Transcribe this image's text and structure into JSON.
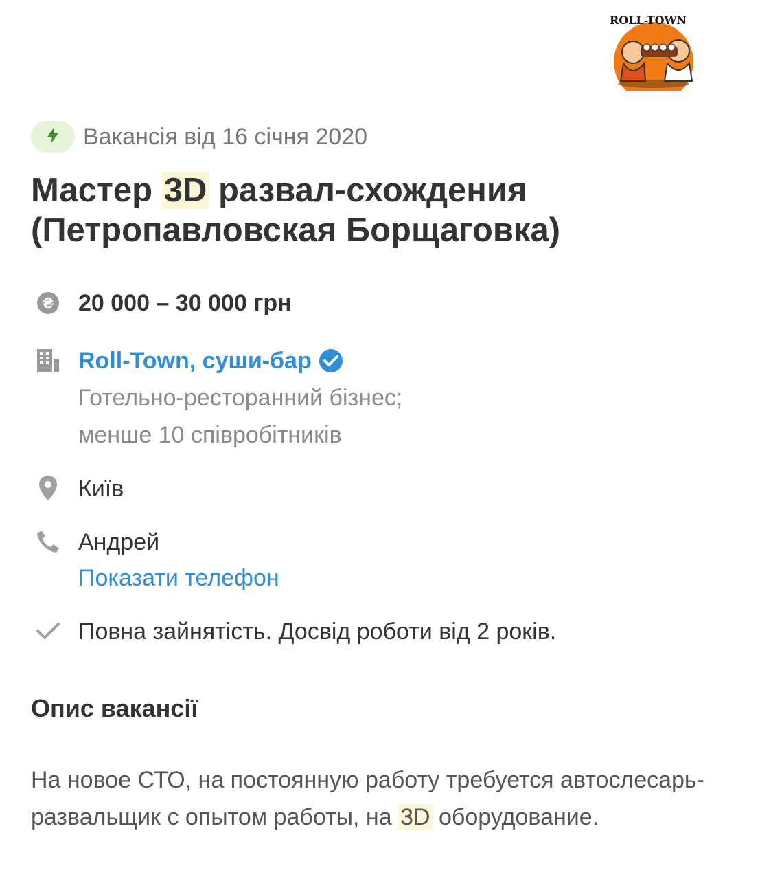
{
  "logo": {
    "text": "ROLL-TOWN"
  },
  "posting": {
    "date": "Вакансія від 16 січня 2020"
  },
  "title": {
    "part1": "Мастер ",
    "highlight": "3D",
    "part2": " развал-схождения (Петропавловская Борщаговка)"
  },
  "salary": "20 000 – 30 000 грн",
  "company": {
    "name": "Roll-Town, суши-бар",
    "industry": "Готельно-ресторанний бізнес;",
    "size": "менше 10 співробітників"
  },
  "location": "Київ",
  "contact": {
    "name": "Андрей",
    "show_phone": "Показати телефон"
  },
  "conditions": "Повна зайнятість. Досвід роботи від 2 років.",
  "description": {
    "heading": "Опис вакансії",
    "part1": "На новое СТО, на постоянную работу требуется автослесарь-развальщик с опытом работы, на ",
    "highlight": "3D",
    "part2": " оборудование."
  },
  "colors": {
    "link": "#2f8fd8",
    "badge_bg": "#e6f5d9",
    "highlight_bg": "#fbf6d5",
    "logo_orange": "#f07a14"
  },
  "icons": [
    "lightning-icon",
    "currency-icon",
    "building-icon",
    "verified-icon",
    "location-pin-icon",
    "phone-icon",
    "checkmark-icon"
  ]
}
